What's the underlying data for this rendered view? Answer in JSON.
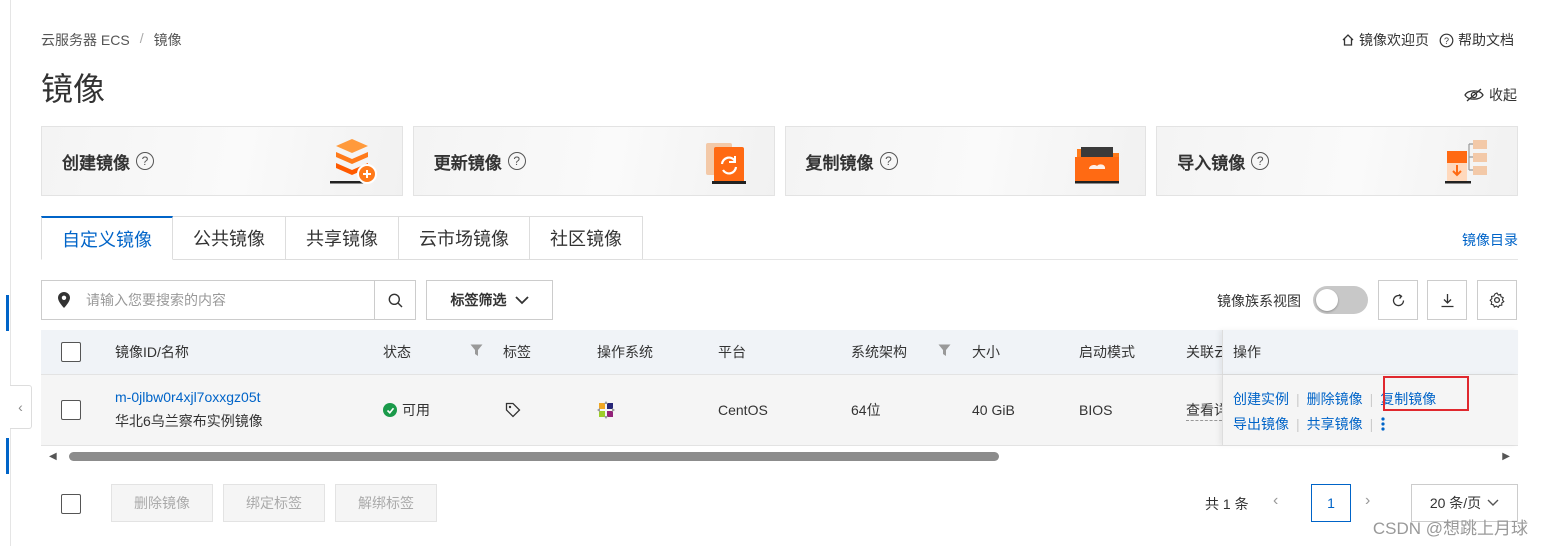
{
  "breadcrumb": {
    "root": "云服务器 ECS",
    "separator": "/",
    "current": "镜像"
  },
  "top_links": {
    "welcome": "镜像欢迎页",
    "help": "帮助文档"
  },
  "page_title": "镜像",
  "collapse_label": "收起",
  "cards": [
    {
      "label": "创建镜像",
      "icon": "create-image-illustration"
    },
    {
      "label": "更新镜像",
      "icon": "update-image-illustration"
    },
    {
      "label": "复制镜像",
      "icon": "copy-image-illustration"
    },
    {
      "label": "导入镜像",
      "icon": "import-image-illustration"
    }
  ],
  "tabs": [
    {
      "label": "自定义镜像",
      "active": true
    },
    {
      "label": "公共镜像",
      "active": false
    },
    {
      "label": "共享镜像",
      "active": false
    },
    {
      "label": "云市场镜像",
      "active": false
    },
    {
      "label": "社区镜像",
      "active": false
    }
  ],
  "catalog_link": "镜像目录",
  "search": {
    "placeholder": "请输入您要搜索的内容"
  },
  "tag_filter_label": "标签筛选",
  "family_view_label": "镜像族系视图",
  "table": {
    "headers": {
      "id_name": "镜像ID/名称",
      "status": "状态",
      "tags": "标签",
      "os": "操作系统",
      "platform": "平台",
      "arch": "系统架构",
      "size": "大小",
      "boot_mode": "启动模式",
      "related": "关联云",
      "operations": "操作"
    },
    "rows": [
      {
        "id": "m-0jlbw0r4xjl7oxxgz05t",
        "name": "华北6乌兰察布实例镜像",
        "status": "可用",
        "platform": "CentOS",
        "arch": "64位",
        "size": "40 GiB",
        "boot_mode": "BIOS",
        "related": "查看详",
        "ops": {
          "create_instance": "创建实例",
          "delete_image": "删除镜像",
          "copy_image": "复制镜像",
          "export_image": "导出镜像",
          "share_image": "共享镜像"
        }
      }
    ]
  },
  "bulk_actions": {
    "delete": "删除镜像",
    "bind_tag": "绑定标签",
    "unbind_tag": "解绑标签"
  },
  "pagination": {
    "total": "共 1 条",
    "current_page": "1",
    "page_size": "20 条/页"
  },
  "watermark": "CSDN @想跳上月球",
  "colors": {
    "accent": "#0064c8",
    "status_ok": "#1a9a4a",
    "highlight": "#e0282e"
  }
}
